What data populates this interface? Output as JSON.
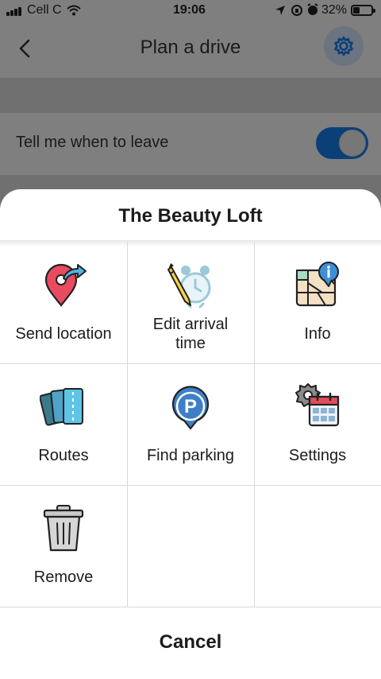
{
  "status_bar": {
    "carrier": "Cell C",
    "time": "19:06",
    "battery": "32%"
  },
  "header": {
    "title": "Plan a drive",
    "back_icon": "chevron-left-icon",
    "settings_icon": "gear-icon"
  },
  "row": {
    "label": "Tell me when to leave",
    "toggle_on": true
  },
  "sheet": {
    "title": "The Beauty Loft",
    "actions": [
      {
        "label": "Send location",
        "icon": "send-location-icon"
      },
      {
        "label": "Edit arrival\ntime",
        "icon": "edit-arrival-time-icon"
      },
      {
        "label": "Info",
        "icon": "map-info-icon"
      },
      {
        "label": "Routes",
        "icon": "routes-icon"
      },
      {
        "label": "Find parking",
        "icon": "parking-icon"
      },
      {
        "label": "Settings",
        "icon": "settings-calendar-icon"
      },
      {
        "label": "Remove",
        "icon": "trash-icon"
      }
    ],
    "cancel": "Cancel"
  },
  "colors": {
    "accent": "#0b3f78",
    "overlay": "#7b7b7b",
    "sheet_bg": "#ffffff"
  }
}
